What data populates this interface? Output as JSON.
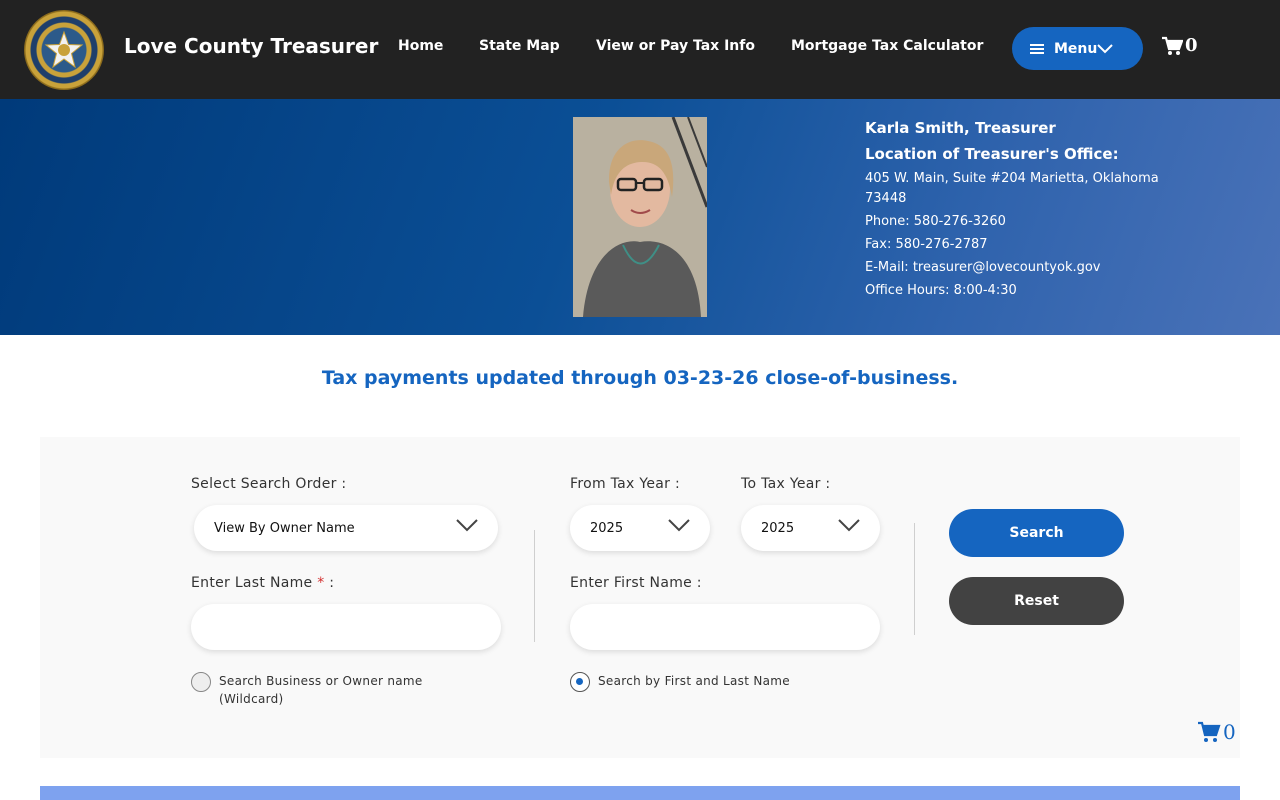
{
  "header": {
    "site_title": "Love County Treasurer",
    "nav": [
      "Home",
      "State Map",
      "View or Pay Tax Info",
      "Mortgage Tax Calculator"
    ],
    "menu_label": "Menu",
    "cart_count": "0"
  },
  "banner": {
    "treasurer_name": "Karla Smith, Treasurer",
    "location_heading": "Location of Treasurer's Office:",
    "address": "405 W. Main, Suite #204 Marietta, Oklahoma 73448",
    "phone": "Phone: 580-276-3260",
    "fax": "Fax: 580-276-2787",
    "email": "E-Mail: treasurer@lovecountyok.gov",
    "hours": "Office Hours: 8:00-4:30"
  },
  "notice": "Tax payments updated through 03-23-26 close-of-business.",
  "search": {
    "order_label": "Select Search Order :",
    "order_value": "View By Owner Name",
    "from_year_label": "From Tax Year :",
    "from_year_value": "2025",
    "to_year_label": "To Tax Year :",
    "to_year_value": "2025",
    "last_name_label": "Enter Last Name",
    "last_name_required": "*",
    "last_name_colon": ":",
    "last_name_value": "",
    "first_name_label": "Enter First Name :",
    "first_name_value": "",
    "radio_wildcard_label": "Search Business or Owner name (Wildcard)",
    "radio_wildcard_checked": false,
    "radio_firstlast_label": "Search by First and Last Name",
    "radio_firstlast_checked": true,
    "search_button": "Search",
    "reset_button": "Reset",
    "cart_count": "0"
  },
  "colors": {
    "header_bg": "#222222",
    "accent": "#1565c0",
    "reset_bg": "#424242",
    "banner_start": "#003a7a",
    "banner_end": "#4a72b8"
  }
}
